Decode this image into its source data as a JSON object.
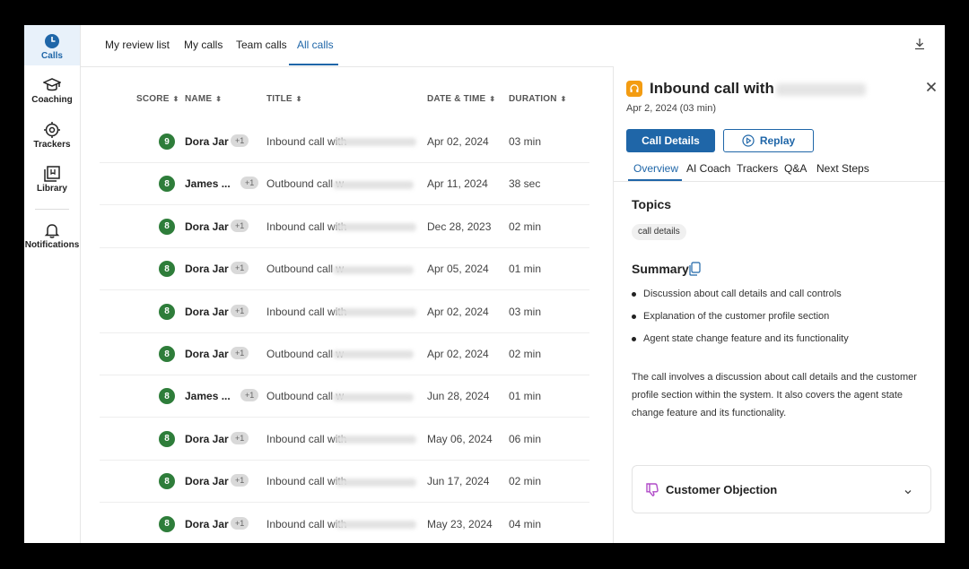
{
  "rail": {
    "items": [
      {
        "label": "Calls",
        "icon": "clock-icon"
      },
      {
        "label": "Coaching",
        "icon": "graduation-cap-icon"
      },
      {
        "label": "Trackers",
        "icon": "target-icon"
      },
      {
        "label": "Library",
        "icon": "library-icon"
      },
      {
        "label": "Notifications",
        "icon": "bell-icon"
      }
    ]
  },
  "topnav": {
    "tabs": [
      {
        "label": "My review list"
      },
      {
        "label": "My calls"
      },
      {
        "label": "Team calls"
      },
      {
        "label": "All calls"
      }
    ],
    "active_tab": "All calls",
    "download_icon": "download-icon"
  },
  "table": {
    "headers": {
      "score": "SCORE",
      "name": "NAME",
      "title": "TITLE",
      "date": "DATE & TIME",
      "duration": "DURATION"
    },
    "rows": [
      {
        "score": "9",
        "name": "Dora Jar",
        "extra": "+1",
        "title": "Inbound call with",
        "date": "Apr 02, 2024",
        "duration": "03 min"
      },
      {
        "score": "8",
        "name": "James ...",
        "extra": "+1",
        "title": "Outbound call w",
        "date": "Apr 11, 2024",
        "duration": "38 sec"
      },
      {
        "score": "8",
        "name": "Dora Jar",
        "extra": "+1",
        "title": "Inbound call with",
        "date": "Dec 28, 2023",
        "duration": "02 min"
      },
      {
        "score": "8",
        "name": "Dora Jar",
        "extra": "+1",
        "title": "Outbound call w",
        "date": "Apr 05, 2024",
        "duration": "01 min"
      },
      {
        "score": "8",
        "name": "Dora Jar",
        "extra": "+1",
        "title": "Inbound call with",
        "date": "Apr 02, 2024",
        "duration": "03 min"
      },
      {
        "score": "8",
        "name": "Dora Jar",
        "extra": "+1",
        "title": "Outbound call w",
        "date": "Apr 02, 2024",
        "duration": "02 min"
      },
      {
        "score": "8",
        "name": "James ...",
        "extra": "+1",
        "title": "Outbound call w",
        "date": "Jun 28, 2024",
        "duration": "01 min"
      },
      {
        "score": "8",
        "name": "Dora Jar",
        "extra": "+1",
        "title": "Inbound call with",
        "date": "May 06, 2024",
        "duration": "06 min"
      },
      {
        "score": "8",
        "name": "Dora Jar",
        "extra": "+1",
        "title": "Inbound call with",
        "date": "Jun 17, 2024",
        "duration": "02 min"
      },
      {
        "score": "8",
        "name": "Dora Jar",
        "extra": "+1",
        "title": "Inbound call with",
        "date": "May 23, 2024",
        "duration": "04 min"
      }
    ]
  },
  "panel": {
    "title": "Inbound call with",
    "date": "Apr 2, 2024",
    "length": "(03 min)",
    "buttons": {
      "primary": "Call Details",
      "secondary": "Replay"
    },
    "tabs": [
      {
        "label": "Overview"
      },
      {
        "label": "AI Coach"
      },
      {
        "label": "Trackers"
      },
      {
        "label": "Q&A"
      },
      {
        "label": "Next Steps"
      }
    ],
    "active_tab": "Overview",
    "topics_heading": "Topics",
    "topics": [
      "call details"
    ],
    "summary_heading": "Summary",
    "summary_bullets": [
      "Discussion about call details and call controls",
      "Explanation of the customer profile section",
      "Agent state change feature and its functionality"
    ],
    "summary_paragraph": "The call involves a discussion about call details and the customer profile section within the system. It also covers the agent state change feature and its functionality.",
    "accordion_label": "Customer Objection"
  },
  "colors": {
    "accent": "#1f66a8",
    "score_green": "#2e7d3a",
    "call_icon": "#f39c12"
  }
}
